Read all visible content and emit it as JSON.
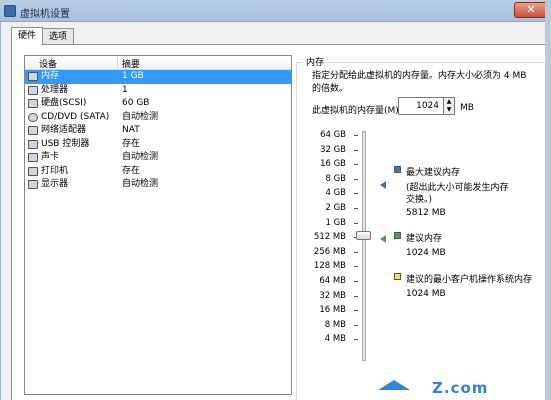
{
  "window": {
    "title": "虚拟机设置",
    "close_glyph": "✕"
  },
  "tabs": [
    {
      "label": "硬件"
    },
    {
      "label": "选项"
    }
  ],
  "device_list": {
    "headers": {
      "device": "设备",
      "summary": "摘要"
    },
    "rows": [
      {
        "name": "内存",
        "value": "1 GB",
        "icon": "memory-icon"
      },
      {
        "name": "处理器",
        "value": "1",
        "icon": "processor-icon"
      },
      {
        "name": "硬盘(SCSI)",
        "value": "60 GB",
        "icon": "hard-disk-icon"
      },
      {
        "name": "CD/DVD (SATA)",
        "value": "自动检测",
        "icon": "cd-dvd-icon"
      },
      {
        "name": "网络适配器",
        "value": "NAT",
        "icon": "network-adapter-icon"
      },
      {
        "name": "USB 控制器",
        "value": "存在",
        "icon": "usb-icon"
      },
      {
        "name": "声卡",
        "value": "自动检测",
        "icon": "sound-card-icon"
      },
      {
        "name": "打印机",
        "value": "存在",
        "icon": "printer-icon"
      },
      {
        "name": "显示器",
        "value": "自动检测",
        "icon": "display-icon"
      }
    ],
    "selected_index": 0
  },
  "memory": {
    "group_title": "内存",
    "description": "指定分配给此虚拟机的内存量。内存大小必须为 4 MB 的倍数。",
    "field_label": "此虚拟机的内存量(M):",
    "value": "1024",
    "unit": "MB",
    "scale_labels": [
      "64 GB",
      "32 GB",
      "16 GB",
      "8 GB",
      "4 GB",
      "2 GB",
      "1 GB",
      "512 MB",
      "256 MB",
      "128 MB",
      "64 MB",
      "32 MB",
      "16 MB",
      "8 MB",
      "4 MB"
    ],
    "legend": {
      "max_recommended": {
        "label": "最大建议内存",
        "note": "(超出此大小可能发生内存交换。)",
        "value": "5812 MB",
        "color": "#3b74c4"
      },
      "recommended": {
        "label": "建议内存",
        "value": "1024 MB",
        "color": "#3ba845"
      },
      "guest_min": {
        "label": "建议的最小客户机操作系统内存",
        "value": "1024 MB",
        "color": "#f0e060"
      }
    }
  },
  "watermark": {
    "text": "Z.com"
  }
}
